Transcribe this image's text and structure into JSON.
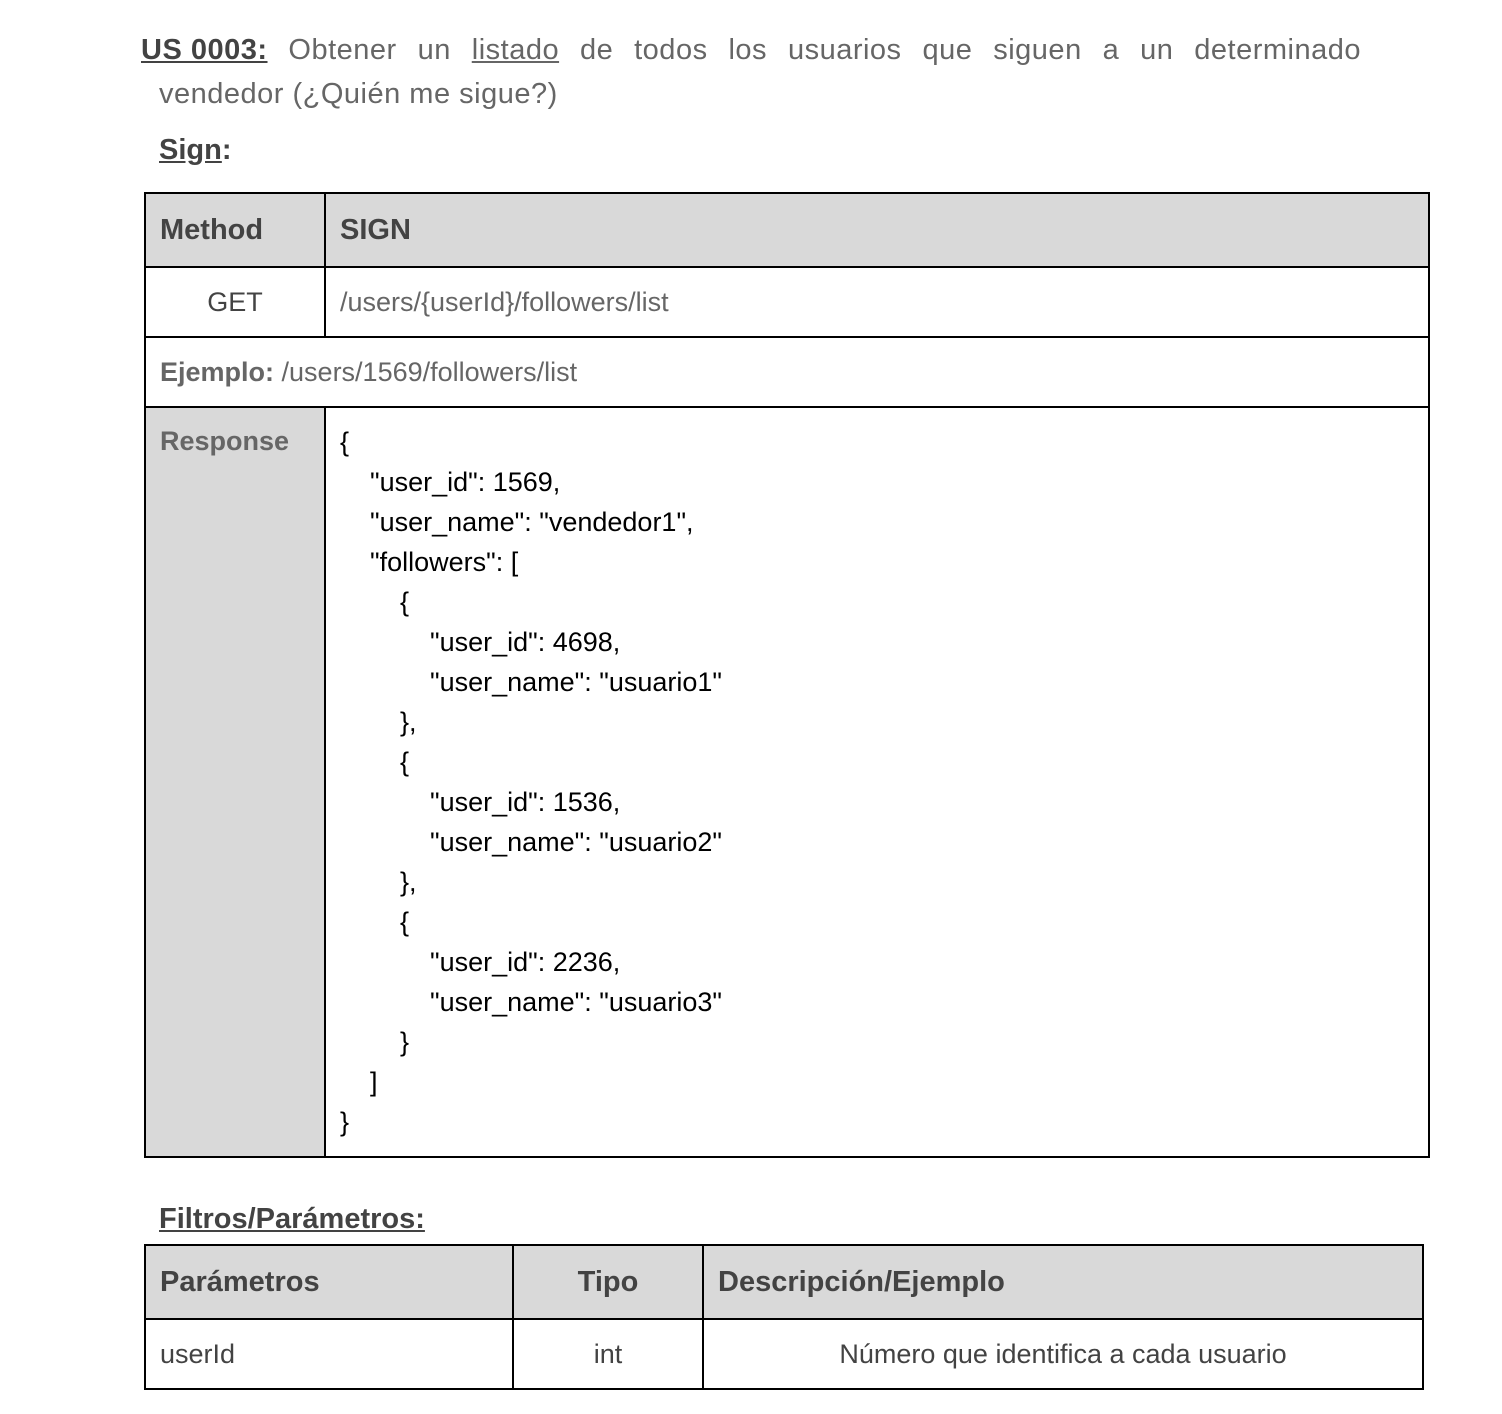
{
  "story": {
    "code": "US 0003:",
    "words_before": [
      "Obtener",
      "un"
    ],
    "link_word": "listado",
    "words_after": [
      "de",
      "todos",
      "los",
      "usuarios",
      "que",
      "siguen",
      "a",
      "un",
      "determinado"
    ],
    "line2": "vendedor (¿Quién me sigue?)"
  },
  "sign": {
    "heading": "Sign",
    "colon": ":"
  },
  "sign_table": {
    "header_method": "Method",
    "header_sign": "SIGN",
    "method": "GET",
    "path": "/users/{userId}/followers/list",
    "example_label": "Ejemplo:",
    "example_value": "/users/1569/followers/list",
    "response_label": "Response",
    "response_body": "{\n    \"user_id\": 1569,\n    \"user_name\": \"vendedor1\",\n    \"followers\": [\n        {\n            \"user_id\": 4698,\n            \"user_name\": \"usuario1\"\n        },\n        {\n            \"user_id\": 1536,\n            \"user_name\": \"usuario2\"\n        },\n        {\n            \"user_id\": 2236,\n            \"user_name\": \"usuario3\"\n        }\n    ]\n}"
  },
  "filters": {
    "heading": "Filtros/Parámetros:",
    "headers": [
      "Parámetros",
      "Tipo",
      "Descripción/Ejemplo"
    ],
    "rows": [
      [
        "userId",
        "int",
        "Número que identifica a cada usuario"
      ]
    ]
  }
}
